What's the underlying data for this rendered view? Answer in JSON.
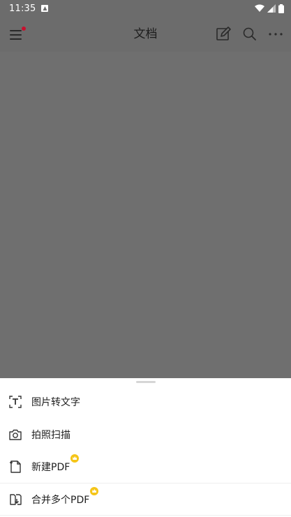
{
  "status_bar": {
    "time": "11:35"
  },
  "app_bar": {
    "title": "文档"
  },
  "sheet": {
    "items": [
      {
        "label": "图片转文字",
        "icon": "text-scan-icon",
        "vip": false
      },
      {
        "label": "拍照扫描",
        "icon": "camera-icon",
        "vip": false
      },
      {
        "label": "新建PDF",
        "icon": "new-file-icon",
        "vip": true
      },
      {
        "label": "合并多个PDF",
        "icon": "merge-pdf-icon",
        "vip": true
      }
    ]
  },
  "colors": {
    "overlay": "#6f6f6f",
    "vip_badge": "#f5c518",
    "notification_dot": "#c8102e"
  }
}
